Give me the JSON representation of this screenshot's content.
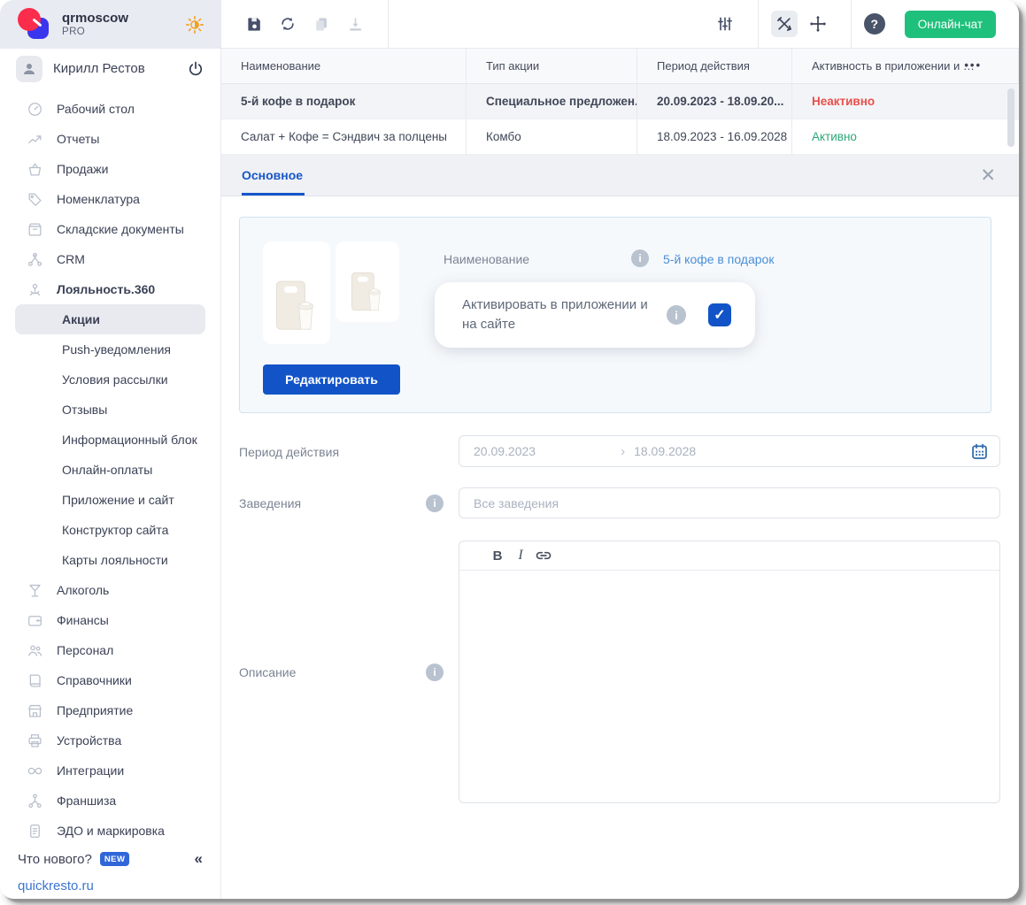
{
  "brand": {
    "name": "qrmoscow",
    "plan": "PRO"
  },
  "user": {
    "name": "Кирилл Рестов"
  },
  "topbar": {
    "chat_button": "Онлайн-чат"
  },
  "sidebar": {
    "items": [
      {
        "key": "desktop",
        "label": "Рабочий стол"
      },
      {
        "key": "reports",
        "label": "Отчеты"
      },
      {
        "key": "sales",
        "label": "Продажи"
      },
      {
        "key": "nomenclature",
        "label": "Номенклатура"
      },
      {
        "key": "warehouse",
        "label": "Складские документы"
      },
      {
        "key": "crm",
        "label": "CRM"
      },
      {
        "key": "loyalty",
        "label": "Лояльность.360",
        "active": true
      }
    ],
    "loyalty_submenu": [
      {
        "key": "promotions",
        "label": "Акции",
        "selected": true
      },
      {
        "key": "push",
        "label": "Push-уведомления"
      },
      {
        "key": "mailing",
        "label": "Условия рассылки"
      },
      {
        "key": "reviews",
        "label": "Отзывы"
      },
      {
        "key": "infoblock",
        "label": "Информационный блок"
      },
      {
        "key": "online-payments",
        "label": "Онлайн-оплаты"
      },
      {
        "key": "app-site",
        "label": "Приложение и сайт"
      },
      {
        "key": "site-builder",
        "label": "Конструктор сайта"
      },
      {
        "key": "loyalty-cards",
        "label": "Карты лояльности"
      }
    ],
    "items_bottom": [
      {
        "key": "alcohol",
        "label": "Алкоголь"
      },
      {
        "key": "finance",
        "label": "Финансы"
      },
      {
        "key": "staff",
        "label": "Персонал"
      },
      {
        "key": "references",
        "label": "Справочники"
      },
      {
        "key": "enterprise",
        "label": "Предприятие"
      },
      {
        "key": "devices",
        "label": "Устройства"
      },
      {
        "key": "integrations",
        "label": "Интеграции"
      },
      {
        "key": "franchise",
        "label": "Франшиза"
      },
      {
        "key": "edo",
        "label": "ЭДО и маркировка"
      }
    ],
    "whats_new": {
      "label": "Что нового?",
      "badge": "NEW"
    },
    "site_link": "quickresto.ru"
  },
  "table": {
    "columns": [
      "Наименование",
      "Тип акции",
      "Период действия",
      "Активность в приложении и н..."
    ],
    "rows": [
      {
        "name": "5-й кофе в подарок",
        "type": "Специальное предложен...",
        "period": "20.09.2023 - 18.09.20...",
        "status": "Неактивно",
        "status_color": "#e84f4a",
        "selected": true
      },
      {
        "name": "Салат + Кофе = Сэндвич за полцены",
        "type": "Комбо",
        "period": "18.09.2023 - 16.09.2028",
        "status": "Активно",
        "status_color": "#2aa876",
        "selected": false
      }
    ]
  },
  "panel": {
    "tab": "Основное",
    "name": {
      "label": "Наименование",
      "value": "5-й кофе в подарок"
    },
    "activate": {
      "label": "Активировать в приложении и на сайте",
      "checked": true
    },
    "edit_button": "Редактировать",
    "period": {
      "label": "Период действия",
      "from": "20.09.2023",
      "to": "18.09.2028"
    },
    "venues": {
      "label": "Заведения",
      "placeholder": "Все заведения"
    },
    "description": {
      "label": "Описание"
    },
    "editor": {
      "bold": "B",
      "italic": "I"
    }
  },
  "colors": {
    "accent_blue": "#1254c8",
    "tab_blue": "#1856c8",
    "link_blue": "#4a8fd9",
    "chat_green": "#1fc07c",
    "status_green": "#2aa876",
    "status_red": "#e84f4a",
    "sidebar_header_bg": "#e9ebf2",
    "badge_blue": "#3166d8"
  }
}
